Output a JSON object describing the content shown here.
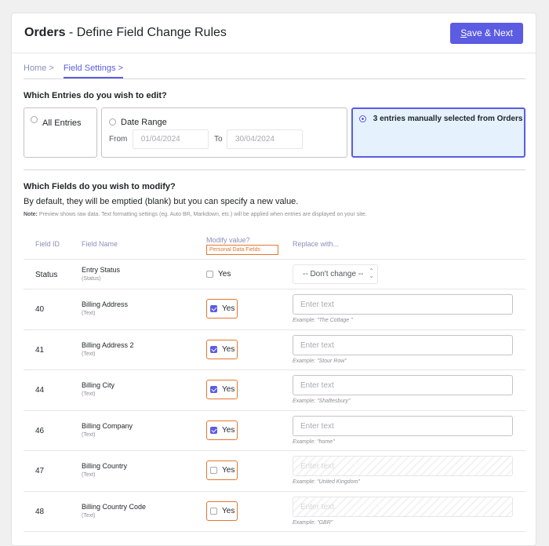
{
  "header": {
    "title_bold": "Orders",
    "title_rest": " - Define Field Change Rules",
    "save_label_underlined": "S",
    "save_label_rest": "ave & Next"
  },
  "breadcrumbs": [
    {
      "label": "Home >"
    },
    {
      "label": "Field Settings >"
    }
  ],
  "entries": {
    "question": "Which Entries do you wish to edit?",
    "all_label": "All Entries",
    "date_range_label": "Date Range",
    "from_label": "From",
    "from_placeholder": "01/04/2024",
    "to_label": "To",
    "to_placeholder": "30/04/2024",
    "manual_label": "3 entries manually selected from ",
    "manual_form": "Orders"
  },
  "fields": {
    "question": "Which Fields do you wish to modify?",
    "description": "By default, they will be emptied (blank) but you can specify a new value.",
    "note_label": "Note:",
    "note_text": " Preview shows raw data. Text formatting settings (eg. Auto BR, Markdown, etc.) will be applied when entries are displayed on your site."
  },
  "table": {
    "col_id": "Field ID",
    "col_name": "Field Name",
    "col_modify": "Modify value?",
    "personal_data_badge": "Personal Data Fields",
    "col_replace": "Replace with...",
    "yes_label": "Yes",
    "input_placeholder": "Enter text",
    "status_row": {
      "id": "Status",
      "name": "Entry Status",
      "type": "(Status)",
      "checked": false,
      "select_value": "-- Don't change --"
    },
    "rows": [
      {
        "id": "40",
        "name": "Billing Address",
        "type": "(Text)",
        "checked": true,
        "example": "Example: \"The Cottage \""
      },
      {
        "id": "41",
        "name": "Billing Address 2",
        "type": "(Text)",
        "checked": true,
        "example": "Example: \"Stour Row\""
      },
      {
        "id": "44",
        "name": "Billing City",
        "type": "(Text)",
        "checked": true,
        "example": "Example: \"Shaftesbury\""
      },
      {
        "id": "46",
        "name": "Billing Company",
        "type": "(Text)",
        "checked": true,
        "example": "Example: \"home\""
      },
      {
        "id": "47",
        "name": "Billing Country",
        "type": "(Text)",
        "checked": false,
        "example": "Example: \"United Kingdom\""
      },
      {
        "id": "48",
        "name": "Billing Country Code",
        "type": "(Text)",
        "checked": false,
        "example": "Example: \"GBR\""
      }
    ]
  },
  "colors": {
    "accent": "#5b5ce2",
    "personal_data": "#e27730",
    "selected_bg": "#e5f1fd"
  }
}
